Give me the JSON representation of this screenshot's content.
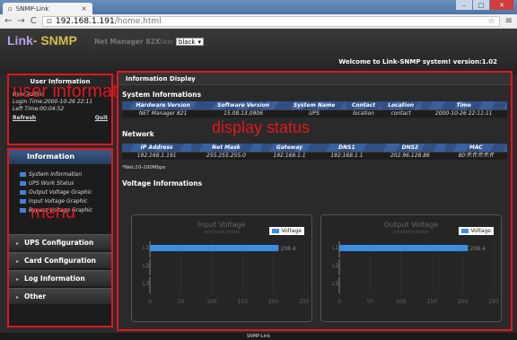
{
  "browser": {
    "tab_title": "SNMP-Link",
    "tab_close": "×",
    "url_host": "192.168.1.191",
    "url_path": "/home.html",
    "window_buttons": [
      "–",
      "□",
      "✕"
    ]
  },
  "header": {
    "logo_a": "Link",
    "logo_sep": "-",
    "logo_b": "SNMP",
    "model": "Net Manager 82X",
    "skin_label": "Skin",
    "skin_value": "black",
    "welcome": "Welcome to Link-SNMP system! version:1.02"
  },
  "user": {
    "title": "User Information",
    "user_line": "User:admin",
    "login_time": "Login Time:2000-10-26 22:11",
    "left_time": "Left Time:00:04:52",
    "refresh": "Refresh",
    "quit": "Quit",
    "annotation": "user information"
  },
  "menu": {
    "head": "Information",
    "items": [
      "System Information",
      "UPS Work Status",
      "Output Voltage Graphic",
      "Input Voltage Graphic",
      "Bypass Voltage Graphic"
    ],
    "annotation": "menu",
    "sections": [
      "UPS Configuration",
      "Card Configuration",
      "Log Information",
      "Other"
    ]
  },
  "main": {
    "title": "Information Display",
    "annotation": "display status",
    "sysinfo_heading": "System Informations",
    "sys_headers": [
      "Hardware Version",
      "Software Version",
      "System Name",
      "Contact",
      "Location",
      "Time"
    ],
    "sys_values": [
      "NET Manager 821",
      "15.08.13.0906",
      "UPS",
      "location",
      "contact",
      "2000-10-26 22:11:11"
    ],
    "network_heading": "Network",
    "net_headers": [
      "IP Address",
      "Net Mask",
      "Gateway",
      "DNS1",
      "DNS2",
      "MAC"
    ],
    "net_values": [
      "192.168.1.191",
      "255.255.255.0",
      "192.168.1.1",
      "192.168.1.1",
      "202.96.128.86",
      "80:ff:ff:ff:ff:ff"
    ],
    "net_note": "*Net:10-100Mbps",
    "voltage_heading": "Voltage Informations"
  },
  "chart_data": [
    {
      "type": "bar",
      "title": "Input Voltage",
      "subtitle": "amcharts meter",
      "categories": [
        "L1",
        "L2",
        "L3"
      ],
      "series": [
        {
          "name": "Voltage",
          "values": [
            208.4,
            0,
            0
          ]
        }
      ],
      "value_label": "208.4",
      "xlim": [
        0,
        250
      ],
      "xticks": [
        0,
        50,
        100,
        150,
        200,
        250
      ]
    },
    {
      "type": "bar",
      "title": "Output Voltage",
      "subtitle": "amcharts meter",
      "categories": [
        "L1",
        "L2",
        "L3"
      ],
      "series": [
        {
          "name": "Voltage",
          "values": [
            208.4,
            0,
            0
          ]
        }
      ],
      "value_label": "208.4",
      "xlim": [
        0,
        250
      ],
      "xticks": [
        0,
        50,
        100,
        150,
        200,
        250
      ]
    }
  ],
  "footer": {
    "text": "SNMP-Link"
  }
}
